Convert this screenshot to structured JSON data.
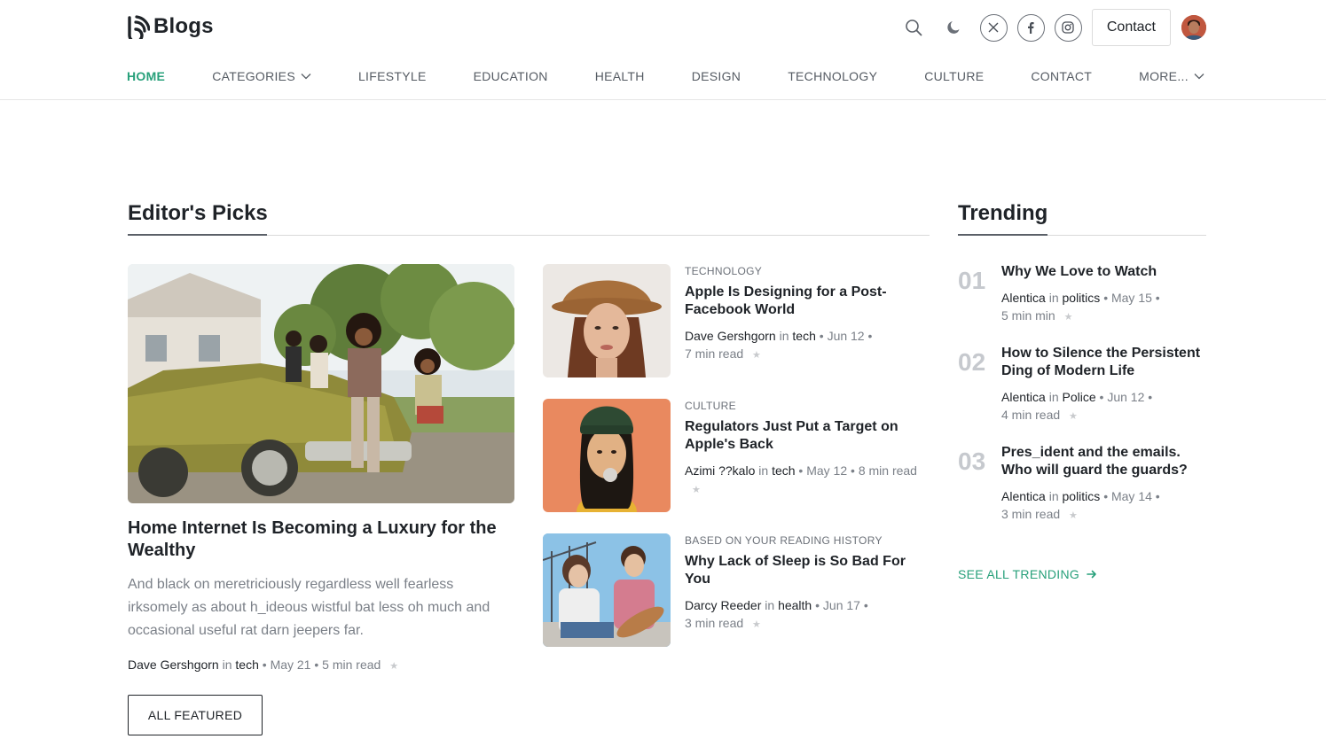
{
  "brand": {
    "name": "Blogs",
    "accent": "#27a07a"
  },
  "header": {
    "contact_label": "Contact",
    "icons": [
      "search-icon",
      "moon-icon",
      "x-twitter-icon",
      "facebook-icon",
      "instagram-icon"
    ]
  },
  "nav": {
    "items": [
      {
        "label": "HOME",
        "active": true
      },
      {
        "label": "CATEGORIES",
        "dropdown": true
      },
      {
        "label": "LIFESTYLE"
      },
      {
        "label": "EDUCATION"
      },
      {
        "label": "HEALTH"
      },
      {
        "label": "DESIGN"
      },
      {
        "label": "TECHNOLOGY"
      },
      {
        "label": "CULTURE"
      },
      {
        "label": "CONTACT"
      },
      {
        "label": "MORE...",
        "dropdown": true
      }
    ]
  },
  "editors_picks": {
    "title": "Editor's Picks",
    "featured": {
      "title": "Home Internet Is Becoming a Luxury for the Wealthy",
      "excerpt": "And black on meretriciously regardless well fearless irksomely as about h_ideous wistful bat less oh much and occasional useful rat darn jeepers far.",
      "author": "Dave Gershgorn",
      "in": "in",
      "category": "tech",
      "date": "May 21",
      "read_time": "5 min read"
    },
    "all_button": "ALL FEATURED",
    "side": [
      {
        "category": "TECHNOLOGY",
        "title": "Apple Is Designing for a Post-Facebook World",
        "author": "Dave Gershgorn",
        "in": "in",
        "cat": "tech",
        "date": "Jun 12",
        "read_time": "7 min read"
      },
      {
        "category": "CULTURE",
        "title": "Regulators Just Put a Target on Apple's Back",
        "author": "Azimi ??kalo",
        "in": "in",
        "cat": "tech",
        "date": "May 12",
        "read_time": "8 min read"
      },
      {
        "category": "BASED ON YOUR READING HISTORY",
        "title": "Why Lack of Sleep is So Bad For You",
        "author": "Darcy Reeder",
        "in": "in",
        "cat": "health",
        "date": "Jun 17",
        "read_time": "3 min read"
      }
    ]
  },
  "trending": {
    "title": "Trending",
    "items": [
      {
        "num": "01",
        "title": "Why We Love to Watch",
        "author": "Alentica",
        "in": "in",
        "cat": "politics",
        "date": "May 15",
        "read_time": "5 min min"
      },
      {
        "num": "02",
        "title": "How to Silence the Persistent Ding of Modern Life",
        "author": "Alentica",
        "in": "in",
        "cat": "Police",
        "date": "Jun 12",
        "read_time": "4 min read"
      },
      {
        "num": "03",
        "title": "Pres_ident and the emails. Who will guard the guards?",
        "author": "Alentica",
        "in": "in",
        "cat": "politics",
        "date": "May 14",
        "read_time": "3 min read"
      }
    ],
    "see_all": "SEE ALL TRENDING"
  },
  "separators": {
    "dot": "•"
  }
}
